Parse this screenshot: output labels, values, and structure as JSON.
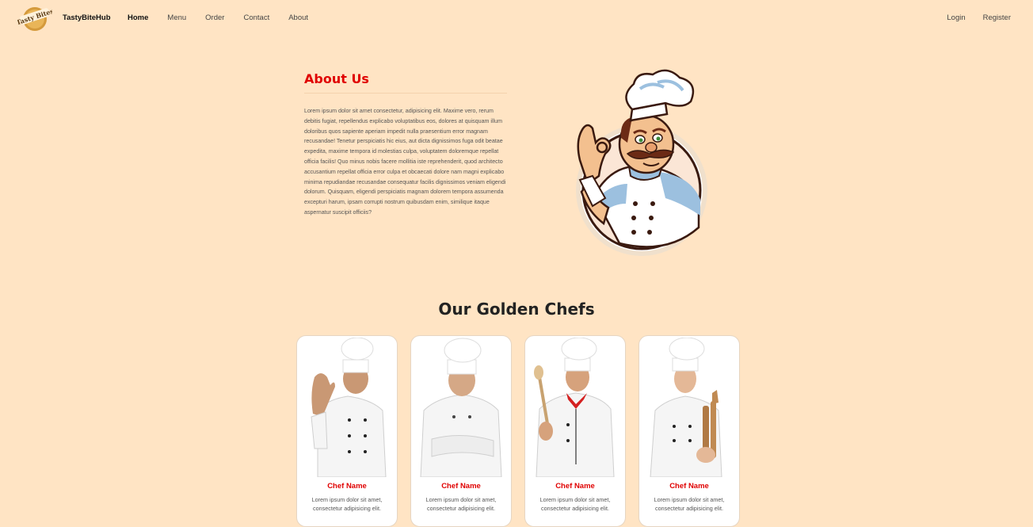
{
  "navbar": {
    "logo_text": "Tasty Bites",
    "brand": "TastyBiteHub",
    "links": [
      {
        "label": "Home"
      },
      {
        "label": "Menu"
      },
      {
        "label": "Order"
      },
      {
        "label": "Contact"
      },
      {
        "label": "About"
      }
    ],
    "login": "Login",
    "register": "Register"
  },
  "about": {
    "title": "About Us",
    "body": "Lorem ipsum dolor sit amet consectetur, adipisicing elit. Maxime vero, rerum debitis fugiat, repellendus explicabo voluptatibus eos, dolores at quisquam illum doloribus quos sapiente aperiam impedit nulla praesentium error magnam recusandae! Tenetur perspiciatis hic eius, aut dicta dignissimos fuga odit beatae expedita, maxime tempora id molestias culpa, voluptatem doloremque repellat officia facilis! Quo minus nobis facere mollitia iste reprehenderit, quod architecto accusantium repellat officia error culpa et obcaecati dolore nam magni explicabo minima repudiandae recusandae consequatur facilis dignissimos veniam eligendi dolorum. Quisquam, eligendi perspiciatis magnam dolorem tempora assumenda excepturi harum, ipsam corrupti nostrum quibusdam enim, similique itaque aspernatur suscipit officiis?"
  },
  "chefs": {
    "title": "Our Golden Chefs",
    "cards": [
      {
        "name": "Chef Name",
        "desc": "Lorem ipsum dolor sit amet, consectetur adipisicing elit."
      },
      {
        "name": "Chef Name",
        "desc": "Lorem ipsum dolor sit amet, consectetur adipisicing elit."
      },
      {
        "name": "Chef Name",
        "desc": "Lorem ipsum dolor sit amet, consectetur adipisicing elit."
      },
      {
        "name": "Chef Name",
        "desc": "Lorem ipsum dolor sit amet, consectetur adipisicing elit."
      }
    ]
  },
  "colors": {
    "background": "#ffe4c4",
    "accent": "#e00000"
  }
}
